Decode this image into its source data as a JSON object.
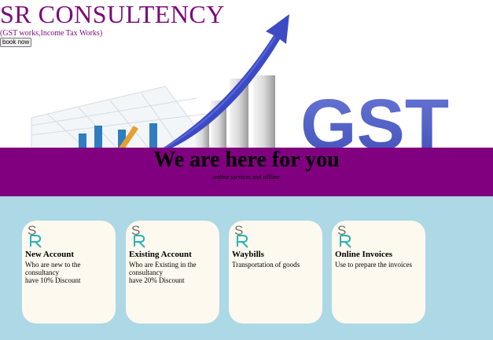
{
  "header": {
    "brand": "SR CONSULTENCY",
    "tagline": "(GST works,Income Tax Works)",
    "book_button": "book now",
    "hero_graphic_text": "GST"
  },
  "band": {
    "title": "We are here for you",
    "subtitle": "online services and offline"
  },
  "cards": [
    {
      "logo": "SR",
      "title": "New Account",
      "lines": [
        "Who are new to the consultancy",
        "have 10% Discount"
      ]
    },
    {
      "logo": "SR",
      "title": "Existing Account",
      "lines": [
        "Who are Existing in the consultancy",
        "have 20% Discount"
      ]
    },
    {
      "logo": "SR",
      "title": "Waybills",
      "lines": [
        "Transportation of goods"
      ]
    },
    {
      "logo": "SR",
      "title": "Online Invoices",
      "lines": [
        "Use to prepare the invoices"
      ]
    }
  ],
  "colors": {
    "brand": "#7a0a78",
    "band": "#800080",
    "cards_bg": "#add8e6",
    "card": "#fdf9ee"
  }
}
